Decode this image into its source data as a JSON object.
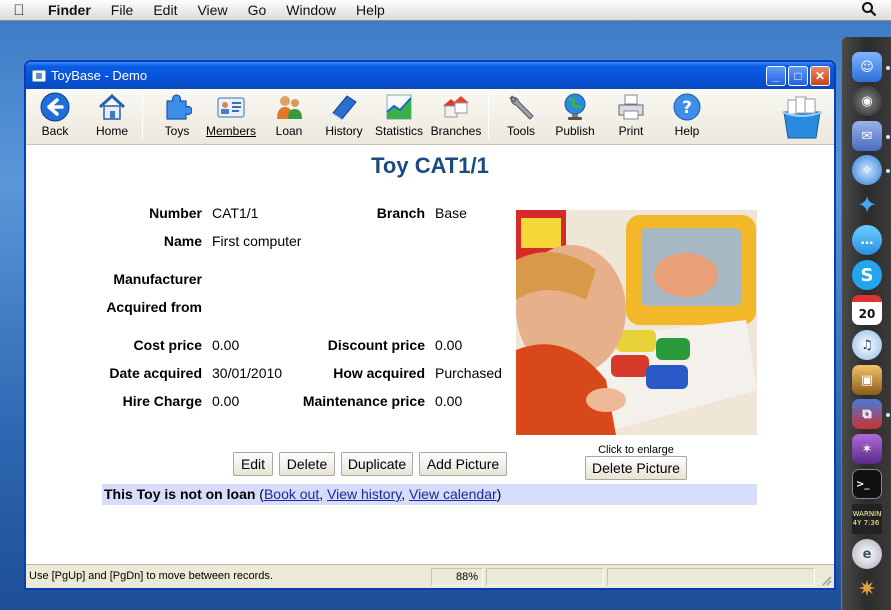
{
  "menubar": {
    "app": "Finder",
    "items": [
      "File",
      "Edit",
      "View",
      "Go",
      "Window",
      "Help"
    ]
  },
  "window": {
    "title": "ToyBase - Demo"
  },
  "toolbar": {
    "back": "Back",
    "home": "Home",
    "toys": "Toys",
    "members": "Members",
    "loan": "Loan",
    "history": "History",
    "statistics": "Statistics",
    "branches": "Branches",
    "tools": "Tools",
    "publish": "Publish",
    "print": "Print",
    "help": "Help"
  },
  "record": {
    "title": "Toy CAT1/1",
    "fields": {
      "number_label": "Number",
      "number_value": "CAT1/1",
      "branch_label": "Branch",
      "branch_value": "Base",
      "name_label": "Name",
      "name_value": "First computer",
      "manufacturer_label": "Manufacturer",
      "manufacturer_value": "",
      "acquired_from_label": "Acquired from",
      "acquired_from_value": "",
      "cost_price_label": "Cost price",
      "cost_price_value": "0.00",
      "discount_price_label": "Discount price",
      "discount_price_value": "0.00",
      "date_acquired_label": "Date acquired",
      "date_acquired_value": "30/01/2010",
      "how_acquired_label": "How acquired",
      "how_acquired_value": "Purchased",
      "hire_charge_label": "Hire Charge",
      "hire_charge_value": "0.00",
      "maintenance_price_label": "Maintenance price",
      "maintenance_price_value": "0.00"
    },
    "photo_caption": "Click to enlarge"
  },
  "actions": {
    "edit": "Edit",
    "delete": "Delete",
    "duplicate": "Duplicate",
    "add_picture": "Add Picture",
    "delete_picture": "Delete Picture"
  },
  "loan_status": {
    "status": "This Toy is not on loan",
    "open_paren": " (",
    "book_out": "Book out",
    "sep1": ", ",
    "view_history": "View history",
    "sep2": ", ",
    "view_calendar": "View calendar",
    "close_paren": ")"
  },
  "statusbar": {
    "hint": "Use [PgUp] and [PgDn] to move between records.",
    "zoom": "88%"
  },
  "dock": {
    "calendar_day": "20",
    "console_text": "WARNIN\n4Y 7:36"
  },
  "colors": {
    "title_blue": "#1a4a80",
    "loan_bar": "#d6dcfa",
    "link": "#1a2a9a"
  }
}
